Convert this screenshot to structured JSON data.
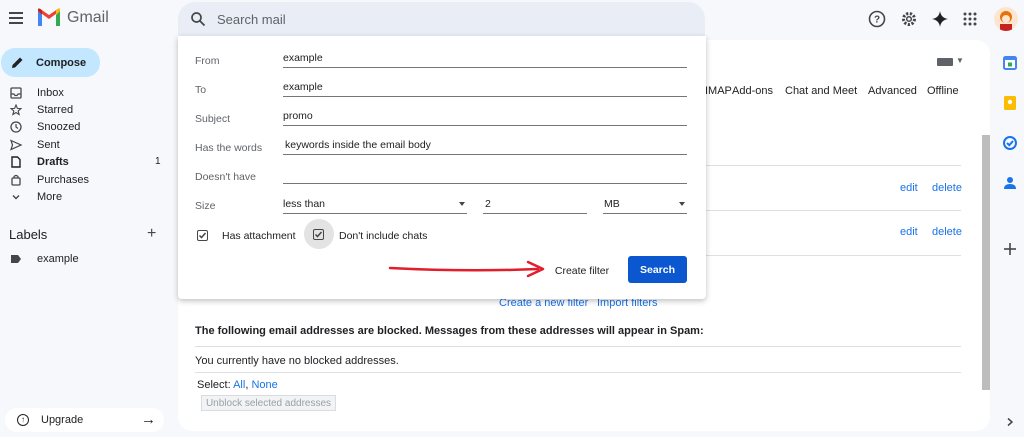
{
  "header": {
    "brand": "Gmail",
    "search_placeholder": "Search mail"
  },
  "sidebar": {
    "compose_label": "Compose",
    "items": [
      {
        "label": "Inbox",
        "icon": "inbox-icon",
        "count": ""
      },
      {
        "label": "Starred",
        "icon": "star-icon",
        "count": ""
      },
      {
        "label": "Snoozed",
        "icon": "clock-icon",
        "count": ""
      },
      {
        "label": "Sent",
        "icon": "send-icon",
        "count": ""
      },
      {
        "label": "Drafts",
        "icon": "file-icon",
        "count": "1"
      },
      {
        "label": "Purchases",
        "icon": "bag-icon",
        "count": ""
      },
      {
        "label": "More",
        "icon": "chevron-down-icon",
        "count": ""
      }
    ],
    "labels_title": "Labels",
    "labels": [
      {
        "label": "example"
      }
    ],
    "upgrade_label": "Upgrade"
  },
  "settings_tabs": [
    "IMAP",
    "Add-ons",
    "Chat and Meet",
    "Advanced",
    "Offline"
  ],
  "filter_rows": [
    {
      "edit": "edit",
      "delete": "delete"
    },
    {
      "edit": "edit",
      "delete": "delete"
    }
  ],
  "filter_links": {
    "create_new": "Create a new filter",
    "import": "Import filters"
  },
  "blocked": {
    "title": "The following email addresses are blocked. Messages from these addresses will appear in Spam:",
    "empty_text": "You currently have no blocked addresses.",
    "select_prefix": "Select:",
    "select_all": "All",
    "select_none": "None",
    "unblock_button": "Unblock selected addresses"
  },
  "filter_dialog": {
    "fields": [
      {
        "label": "From",
        "value": "example"
      },
      {
        "label": "To",
        "value": "example"
      },
      {
        "label": "Subject",
        "value": "promo"
      },
      {
        "label": "Has the words",
        "value": "keywords inside the email body"
      },
      {
        "label": "Doesn't have",
        "value": ""
      }
    ],
    "size": {
      "label": "Size",
      "comparator": "less than",
      "amount": "2",
      "unit": "MB"
    },
    "has_attachment": {
      "label": "Has attachment",
      "checked": true
    },
    "exclude_chats": {
      "label": "Don't include chats",
      "checked": true
    },
    "create_filter_label": "Create filter",
    "search_label": "Search"
  },
  "colors": {
    "compose_bg": "#c2e7ff",
    "primary_button": "#0b57d0",
    "link": "#1a73e8",
    "annotation_arrow": "#e21d2c"
  }
}
